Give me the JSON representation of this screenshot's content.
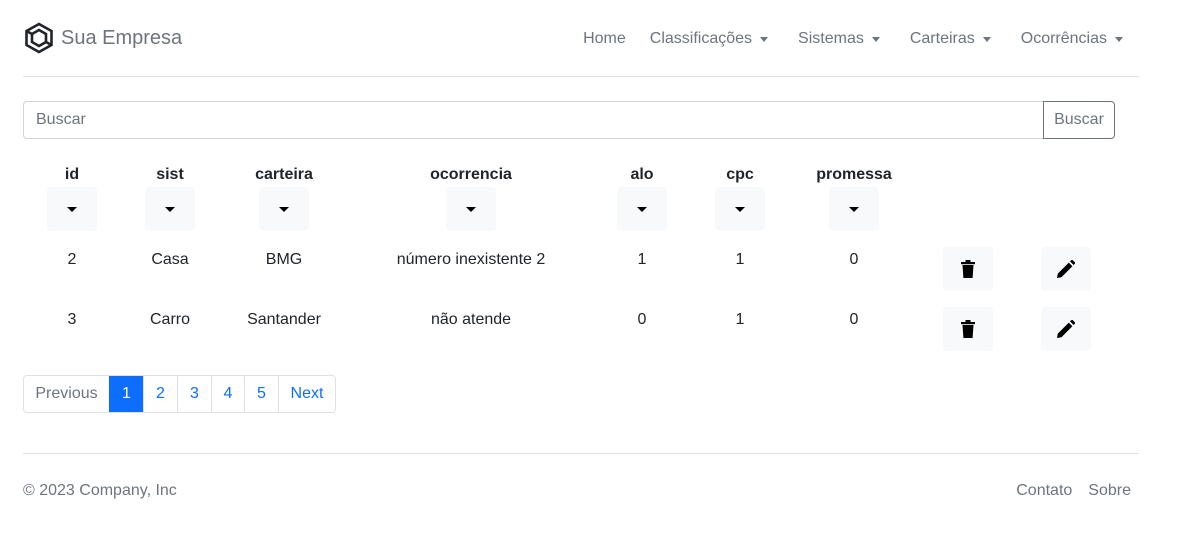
{
  "brand": {
    "name": "Sua Empresa"
  },
  "nav": {
    "home": "Home",
    "classificacoes": "Classificações",
    "sistemas": "Sistemas",
    "carteiras": "Carteiras",
    "ocorrencias": "Ocorrências"
  },
  "search": {
    "placeholder": "Buscar",
    "value": "",
    "button_label": "Buscar"
  },
  "table": {
    "columns": [
      "id",
      "sist",
      "carteira",
      "ocorrencia",
      "alo",
      "cpc",
      "promessa"
    ],
    "rows": [
      [
        "2",
        "Casa",
        "BMG",
        "número inexistente 2",
        "1",
        "1",
        "0"
      ],
      [
        "3",
        "Carro",
        "Santander",
        "não atende",
        "0",
        "1",
        "0"
      ]
    ],
    "row_actions": [
      "trash-icon",
      "pencil-icon"
    ]
  },
  "pagination": {
    "previous": "Previous",
    "pages": [
      "1",
      "2",
      "3",
      "4",
      "5"
    ],
    "next": "Next",
    "active_page": "1"
  },
  "footer": {
    "copyright": "© 2023 Company, Inc",
    "links": [
      "Contato",
      "Sobre"
    ]
  },
  "colors": {
    "accent": "#0d6efd",
    "muted_text": "#6c757d",
    "border": "#dee2e6",
    "button_bg": "#f8f9fa"
  }
}
